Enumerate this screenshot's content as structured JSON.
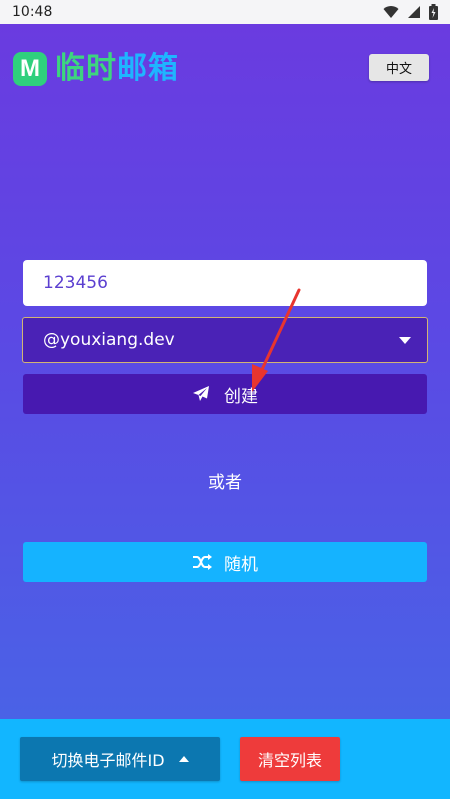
{
  "status_bar": {
    "time": "10:48"
  },
  "header": {
    "logo_letter": "M",
    "title_part1": "临时",
    "title_part2": "邮箱",
    "language_button": "中文"
  },
  "form": {
    "username_value": "123456",
    "domain_selected": "@youxiang.dev",
    "create_label": "创建",
    "or_label": "或者",
    "random_label": "随机"
  },
  "bottom_bar": {
    "switch_label": "切换电子邮件ID",
    "clear_label": "清空列表"
  },
  "colors": {
    "gradient_top": "#6a3be0",
    "gradient_bottom": "#4a62e6",
    "create_button": "#4719b0",
    "random_button": "#15b3ff",
    "bottom_bar": "#12b6ff",
    "switch_button": "#0c77b0",
    "clear_button": "#ee3b3b",
    "logo_green": "#2fd07d",
    "annotation_arrow": "#e8352f"
  },
  "icons": {
    "create": "paper-plane-icon",
    "random": "shuffle-icon",
    "switch": "caret-up-icon",
    "domain": "caret-down-icon"
  }
}
